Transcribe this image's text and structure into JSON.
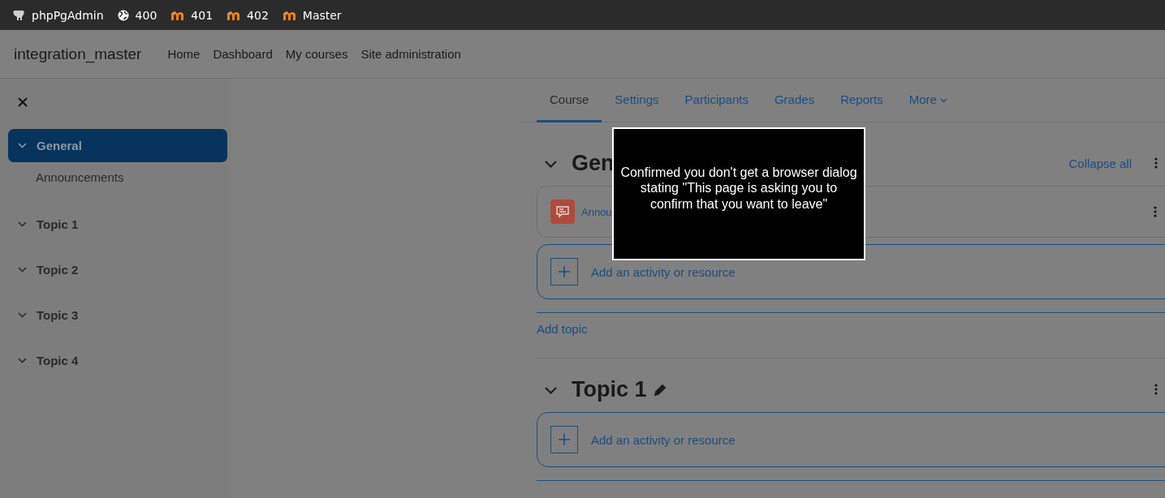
{
  "top_bar": {
    "items": [
      {
        "kind": "elephant",
        "label": "phpPgAdmin"
      },
      {
        "kind": "globe",
        "label": "400"
      },
      {
        "kind": "moodle",
        "label": "401"
      },
      {
        "kind": "moodle",
        "label": "402"
      },
      {
        "kind": "moodle",
        "label": "Master"
      }
    ]
  },
  "navbar": {
    "site_name": "integration_master",
    "links": [
      "Home",
      "Dashboard",
      "My courses",
      "Site administration"
    ]
  },
  "sidebar": {
    "items": [
      {
        "label": "General",
        "selected": true,
        "expanded": true,
        "children": [
          {
            "label": "Announcements",
            "selected": false
          }
        ]
      },
      {
        "label": "Topic 1",
        "selected": false,
        "expanded": true
      },
      {
        "label": "Topic 2",
        "selected": false,
        "expanded": true
      },
      {
        "label": "Topic 3",
        "selected": false,
        "expanded": true
      },
      {
        "label": "Topic 4",
        "selected": false,
        "expanded": true
      }
    ]
  },
  "tabs": [
    {
      "label": "Course",
      "selected": true
    },
    {
      "label": "Settings",
      "selected": false
    },
    {
      "label": "Participants",
      "selected": false
    },
    {
      "label": "Grades",
      "selected": false
    },
    {
      "label": "Reports",
      "selected": false
    },
    {
      "label": "More",
      "selected": false,
      "menu": true
    }
  ],
  "sections": [
    {
      "title": "Gen",
      "collapse_all": "Collapse all",
      "activities": [
        "Annou"
      ],
      "add_activity": "Add an activity or resource",
      "add_topic": "Add topic"
    },
    {
      "title": "Topic 1",
      "editable": true,
      "add_activity": "Add an activity or resource"
    }
  ],
  "dialog": {
    "message": "Confirmed you don't get a browser dialog stating \"This page is asking you to confirm that you want to leave\""
  }
}
